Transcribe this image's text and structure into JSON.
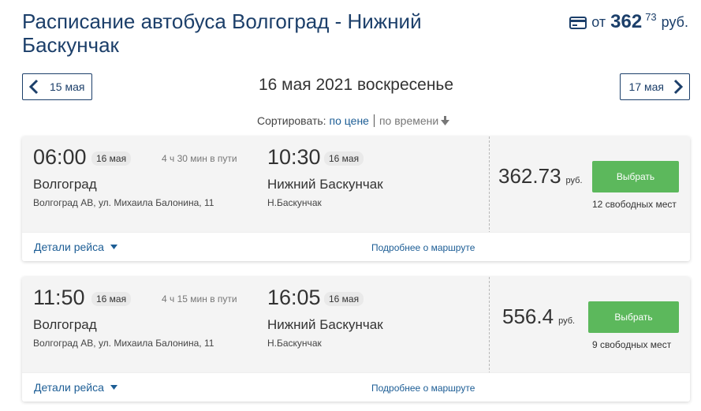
{
  "header": {
    "title": "Расписание автобуса Волгоград - Нижний Баскунчак",
    "min_price": {
      "icon": "credit-card-icon",
      "from_label": "от",
      "amount": "362",
      "cents": "73",
      "currency": "руб."
    }
  },
  "date_nav": {
    "prev_label": "15 мая",
    "current": "16 мая 2021 воскресенье",
    "next_label": "17 мая"
  },
  "sort": {
    "label": "Сортировать:",
    "by_price": "по цене",
    "by_time": "по времени",
    "arrow_icon": "arrow-down-icon"
  },
  "trips": [
    {
      "departure": {
        "time": "06:00",
        "date": "16 мая",
        "city": "Волгоград",
        "stop": "Волгоград АВ, ул. Михаила Балонина, 11"
      },
      "duration": "4 ч 30 мин в пути",
      "arrival": {
        "time": "10:30",
        "date": "16 мая",
        "city": "Нижний Баскунчак",
        "stop": "Н.Баскунчак"
      },
      "price": "362.73",
      "currency": "руб.",
      "select_label": "Выбрать",
      "seats": "12 свободных мест",
      "details_label": "Детали рейса",
      "more_label": "Подробнее о маршруте"
    },
    {
      "departure": {
        "time": "11:50",
        "date": "16 мая",
        "city": "Волгоград",
        "stop": "Волгоград АВ, ул. Михаила Балонина, 11"
      },
      "duration": "4 ч 15 мин в пути",
      "arrival": {
        "time": "16:05",
        "date": "16 мая",
        "city": "Нижний Баскунчак",
        "stop": "Н.Баскунчак"
      },
      "price": "556.4",
      "currency": "руб.",
      "select_label": "Выбрать",
      "seats": "9 свободных мест",
      "details_label": "Детали рейса",
      "more_label": "Подробнее о маршруте"
    }
  ],
  "colors": {
    "brand": "#1c3f6a",
    "link": "#1c5d95",
    "select_button": "#5cb85c"
  }
}
